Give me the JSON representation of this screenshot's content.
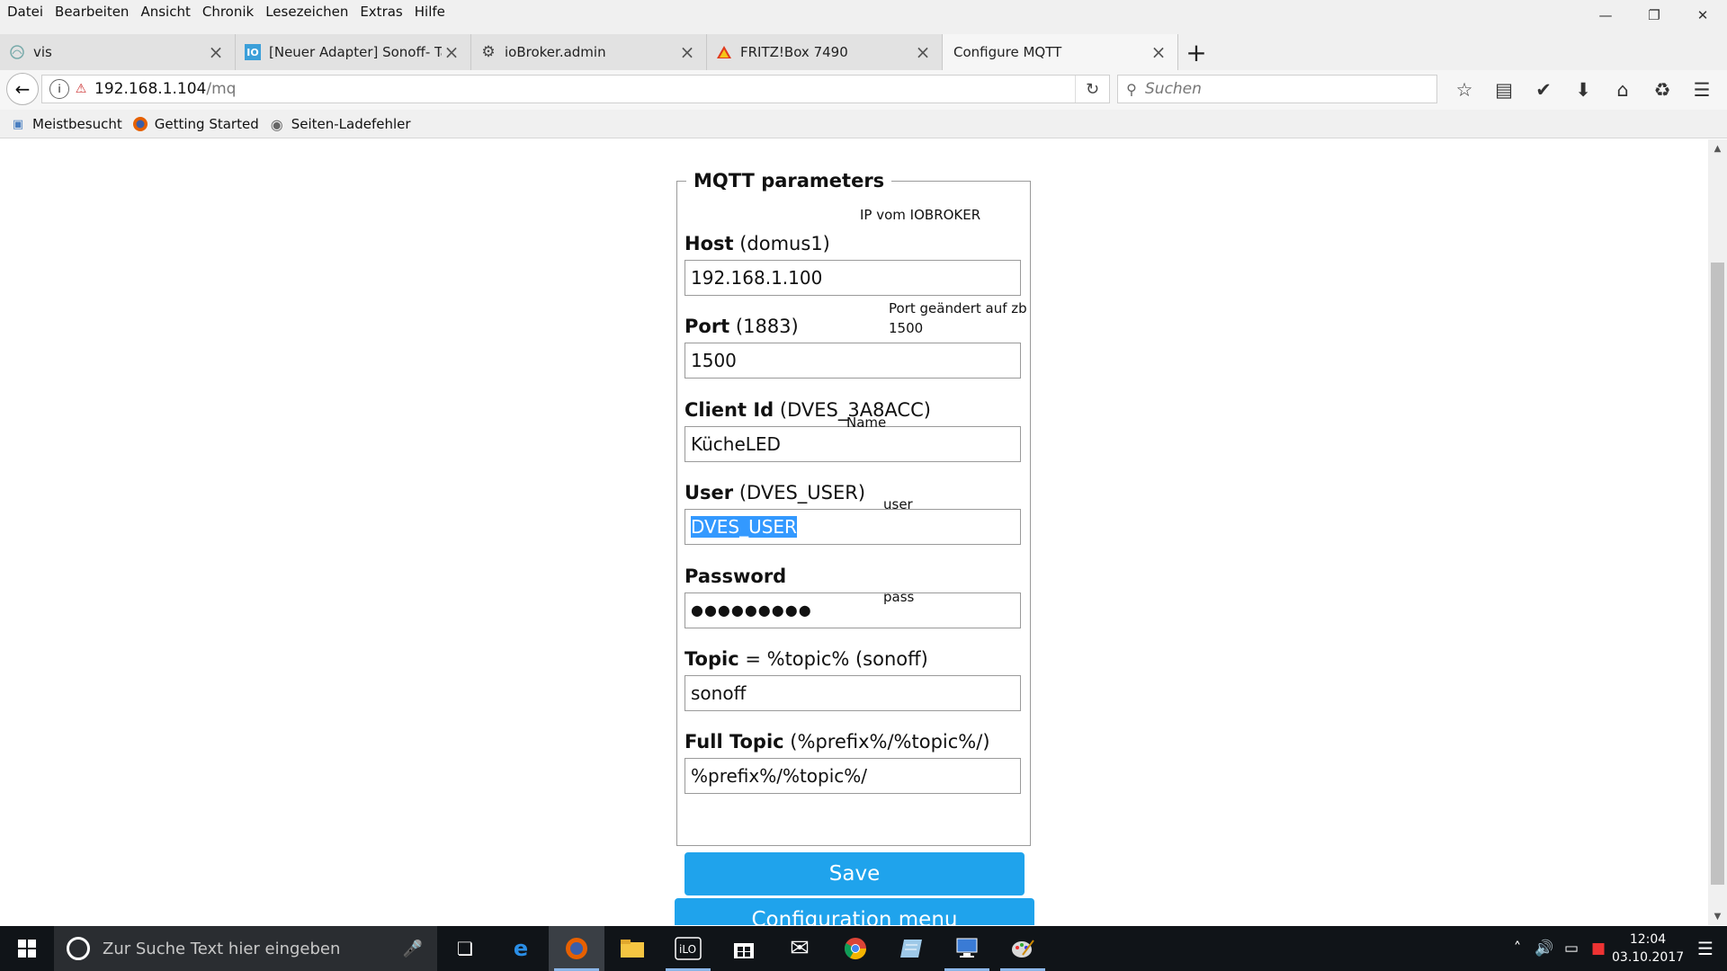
{
  "menu": [
    "Datei",
    "Bearbeiten",
    "Ansicht",
    "Chronik",
    "Lesezeichen",
    "Extras",
    "Hilfe"
  ],
  "tabs": [
    {
      "label": "vis",
      "icon": "vis-icon"
    },
    {
      "label": "[Neuer Adapter] Sonoff- Tas",
      "icon": "iobroker-forum-icon"
    },
    {
      "label": "ioBroker.admin",
      "icon": "gear-icon"
    },
    {
      "label": "FRITZ!Box 7490",
      "icon": "fritzbox-icon"
    },
    {
      "label": "Configure MQTT",
      "icon": ""
    }
  ],
  "url": {
    "host": "192.168.1.104",
    "path": "/mq"
  },
  "search": {
    "placeholder": "Suchen"
  },
  "bookmarks": [
    "Meistbesucht",
    "Getting Started",
    "Seiten-Ladefehler"
  ],
  "form": {
    "legend": "MQTT parameters",
    "host": {
      "label": "Host",
      "hint": "(domus1)",
      "value": "192.168.1.100",
      "note": "IP vom IOBROKER"
    },
    "port": {
      "label": "Port",
      "hint": "(1883)",
      "value": "1500",
      "note_line1": "Port geändert auf zb",
      "note_line2": "1500"
    },
    "client": {
      "label": "Client Id",
      "hint": "(DVES_3A8ACC)",
      "value": "KücheLED",
      "note": "Name"
    },
    "user": {
      "label": "User",
      "hint": "(DVES_USER)",
      "value": "DVES_USER",
      "note": "user"
    },
    "password": {
      "label": "Password",
      "value": "●●●●●●●●●",
      "note": "pass"
    },
    "topic": {
      "label": "Topic",
      "hint": "= %topic% (sonoff)",
      "value": "sonoff"
    },
    "fulltopic": {
      "label": "Full Topic",
      "hint": "(%prefix%/%topic%/)",
      "value": "%prefix%/%topic%/"
    },
    "save": "Save"
  },
  "config_menu": "Configuration menu",
  "taskbar": {
    "search_placeholder": "Zur Suche Text hier eingeben",
    "time": "12:04",
    "date": "03.10.2017"
  },
  "colors": {
    "button": "#1fa3ec",
    "taskbar": "#101418",
    "selection": "#3399ff"
  }
}
